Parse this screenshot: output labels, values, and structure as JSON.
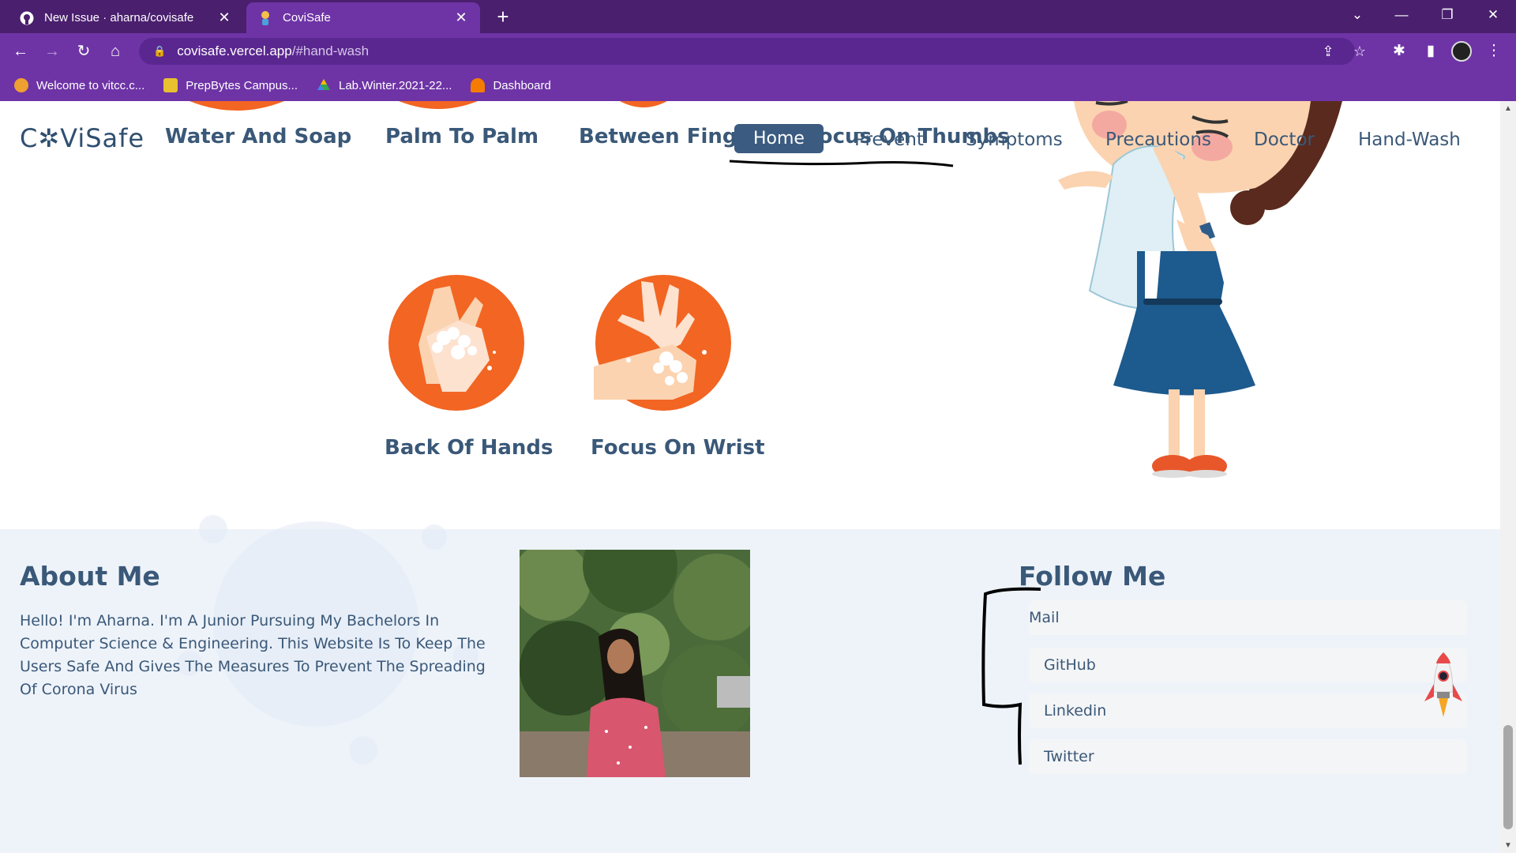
{
  "browser": {
    "tabs": [
      {
        "title": "New Issue · aharna/covisafe",
        "icon": "github-icon",
        "active": false
      },
      {
        "title": "CoviSafe",
        "icon": "covisafe-favicon",
        "active": true
      }
    ],
    "new_tab": "+",
    "window_controls": {
      "dropdown": "⌄",
      "minimize": "—",
      "restore": "❐",
      "close": "✕"
    },
    "url_host": "covisafe.vercel.app",
    "url_path": "/#hand-wash",
    "bookmarks": [
      {
        "label": "Welcome to vitcc.c...",
        "icon": "vit-icon",
        "color": "#f0a030"
      },
      {
        "label": "PrepBytes Campus...",
        "icon": "prepbytes-icon",
        "color": "#e8c030"
      },
      {
        "label": "Lab.Winter.2021-22...",
        "icon": "google-drive-icon",
        "color": "#34a853"
      },
      {
        "label": "Dashboard",
        "icon": "dashboard-icon",
        "color": "#f57c00"
      }
    ]
  },
  "site": {
    "logo": "C✲ViSafe",
    "nav": [
      {
        "label": "Home",
        "active": true
      },
      {
        "label": "Prevent",
        "active": false
      },
      {
        "label": "Symptoms",
        "active": false
      },
      {
        "label": "Precautions",
        "active": false
      },
      {
        "label": "Doctor",
        "active": false
      },
      {
        "label": "Hand-Wash",
        "active": false
      }
    ],
    "steps_top": [
      "Water And Soap",
      "Palm To Palm",
      "Between Fingurs",
      "Focus On Thumbs"
    ],
    "steps": [
      {
        "label": "Back Of Hands"
      },
      {
        "label": "Focus On Wrist"
      }
    ],
    "colors": {
      "accent": "#3b5b80",
      "orange": "#f26522",
      "text": "#3a5878",
      "footer_bg": "#eef3fa"
    }
  },
  "footer": {
    "about_title": "About Me",
    "about_text": "Hello! I'm Aharna. I'm A Junior Pursuing My Bachelors In Computer Science & Engineering. This Website Is To Keep The Users Safe And Gives The Measures To Prevent The Spreading Of Corona Virus",
    "follow_title": "Follow Me",
    "links": [
      "Mail",
      "GitHub",
      "Linkedin",
      "Twitter"
    ]
  }
}
